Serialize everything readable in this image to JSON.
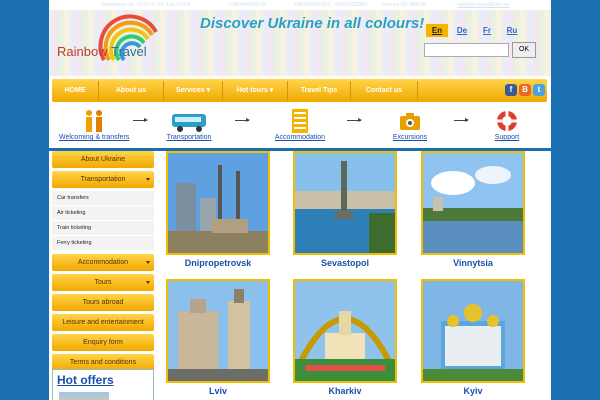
{
  "topbar": {
    "address_label": "Address:",
    "address": "Rebinskoye str. 31/16 of. 14, Kyiv 01034",
    "phone_label": "Phone:",
    "phone": "+380444828579",
    "cell_label": "Cell.:",
    "cell": "+380506580913, +380971820817",
    "license": "Licence AG 580628",
    "email_label": "E-Mail:",
    "email": "rainbow-travel@ukr.net"
  },
  "logo": {
    "word1": "Rainbow",
    "word2": "Travel"
  },
  "slogan": "Discover Ukraine in all colours!",
  "languages": [
    "En",
    "De",
    "Fr",
    "Ru"
  ],
  "search": {
    "button": "OK",
    "placeholder": ""
  },
  "nav": [
    "HOME",
    "About us",
    "Services",
    "Hot tours",
    "Travel Tips",
    "Contact us"
  ],
  "social": [
    "f",
    "B",
    "t"
  ],
  "services": [
    "Welcoming & transfers",
    "Transportation",
    "Accommodation",
    "Excursions",
    "Support"
  ],
  "sidebar": {
    "about": "About Ukraine",
    "transportation": "Transportation",
    "transport_sub": [
      "Car transfers",
      "Air ticketing",
      "Train ticketing",
      "Ferry ticketing"
    ],
    "accommodation": "Accommodation",
    "tours": "Tours",
    "tours_abroad": "Tours abroad",
    "leisure": "Leisure and entertainment",
    "enquiry": "Enquiry form",
    "terms": "Terms and conditions"
  },
  "hot_offers": "Hot offers",
  "cities": [
    "Dnipropetrovsk",
    "Sevastopol",
    "Vinnytsia",
    "Lviv",
    "Kharkiv",
    "Kyiv"
  ],
  "colors": {
    "accent": "#f2a800",
    "page_bg": "#1a6fb0",
    "link": "#1a4fb0",
    "slogan": "#2aa0c7"
  }
}
